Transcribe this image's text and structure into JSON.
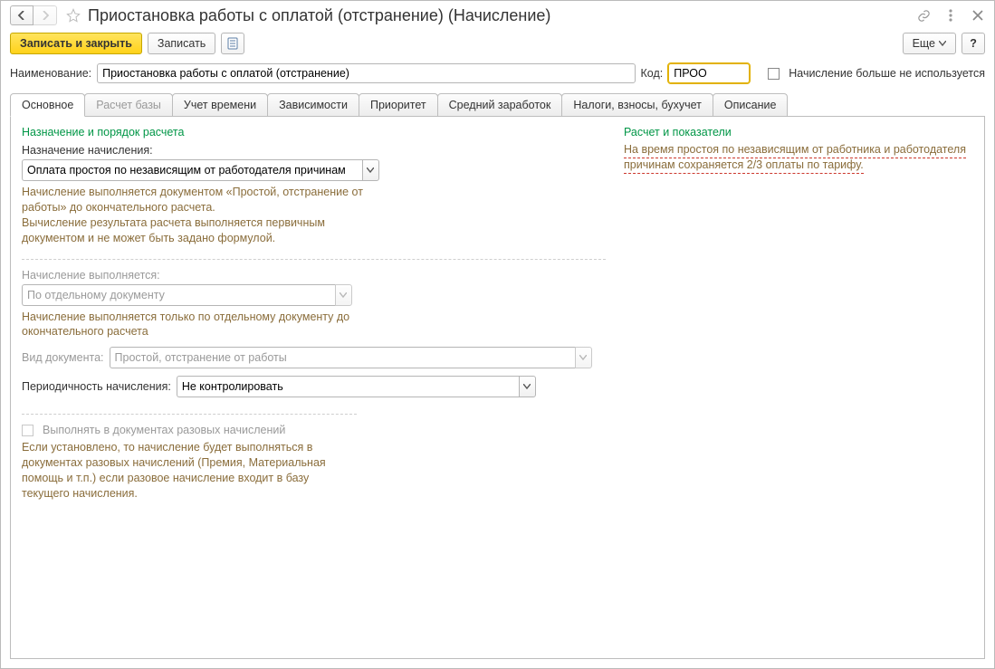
{
  "title": "Приостановка работы с оплатой (отстранение) (Начисление)",
  "toolbar": {
    "save_close": "Записать и закрыть",
    "save": "Записать",
    "more": "Еще"
  },
  "header": {
    "name_label": "Наименование:",
    "name_value": "Приостановка работы с оплатой (отстранение)",
    "code_label": "Код:",
    "code_value": "ПРОО ",
    "not_used_label": "Начисление больше не используется"
  },
  "tabs": [
    "Основное",
    "Расчет базы",
    "Учет времени",
    "Зависимости",
    "Приоритет",
    "Средний заработок",
    "Налоги, взносы, бухучет",
    "Описание"
  ],
  "active_tab": 0,
  "dim_tabs": [
    1
  ],
  "main": {
    "left": {
      "section1_title": "Назначение и порядок расчета",
      "purpose_label": "Назначение начисления:",
      "purpose_value": "Оплата простоя по независящим от работодателя причинам",
      "purpose_hint": "Начисление выполняется документом «Простой, отстранение от работы» до окончательного расчета.\nВычисление результата расчета выполняется первичным документом и не может быть задано формулой.",
      "exec_label": "Начисление выполняется:",
      "exec_value": "По отдельному документу",
      "exec_hint": "Начисление выполняется только по отдельному документу до окончательного расчета",
      "doc_type_label": "Вид документа:",
      "doc_type_value": "Простой, отстранение от работы",
      "period_label": "Периодичность начисления:",
      "period_value": "Не контролировать",
      "oneoff_check_label": "Выполнять в документах разовых начислений",
      "oneoff_hint": "Если установлено, то начисление будет выполняться в документах разовых начислений (Премия, Материальная помощь и т.п.) если разовое начисление входит в базу текущего начисления."
    },
    "right": {
      "section_title": "Расчет и показатели",
      "text": "На время простоя по независящим от работника и работодателя причинам сохраняется 2/3 оплаты по тарифу."
    }
  }
}
